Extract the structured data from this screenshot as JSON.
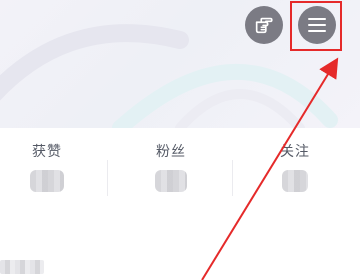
{
  "header": {
    "gesture_icon": "pointing-hand-icon",
    "menu_icon": "hamburger-menu-icon"
  },
  "stats": [
    {
      "label": "获赞"
    },
    {
      "label": "粉丝"
    },
    {
      "label": "关注"
    }
  ],
  "annotation": {
    "highlight_color": "#e52a2a",
    "arrow_color": "#e52a2a"
  },
  "colors": {
    "icon_button_bg": "#7b7b84",
    "label_text": "#555a66"
  }
}
